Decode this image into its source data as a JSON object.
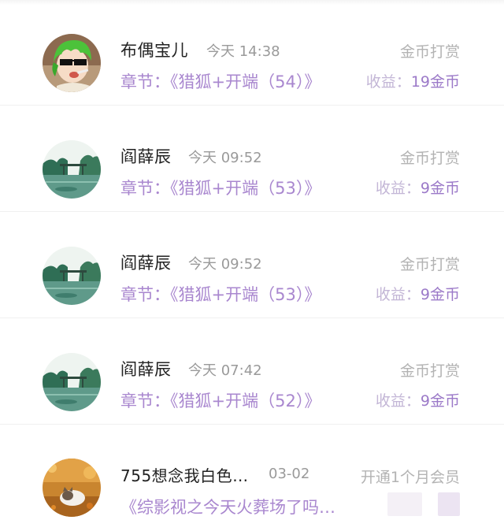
{
  "income_list": [
    {
      "name": "布偶宝儿",
      "time": "今天 14:38",
      "type": "金币打赏",
      "chapter": "章节：《猎狐+开端（54）》",
      "earning_label": "收益：",
      "earning_value": "19金币",
      "avatar": "anime-avatar"
    },
    {
      "name": "阎薛辰",
      "time": "今天 09:52",
      "type": "金币打赏",
      "chapter": "章节：《猎狐+开端（53）》",
      "earning_label": "收益：",
      "earning_value": "9金币",
      "avatar": "landscape-avatar"
    },
    {
      "name": "阎薛辰",
      "time": "今天 09:52",
      "type": "金币打赏",
      "chapter": "章节：《猎狐+开端（53）》",
      "earning_label": "收益：",
      "earning_value": "9金币",
      "avatar": "landscape-avatar"
    },
    {
      "name": "阎薛辰",
      "time": "今天 07:42",
      "type": "金币打赏",
      "chapter": "章节：《猎狐+开端（52）》",
      "earning_label": "收益：",
      "earning_value": "9金币",
      "avatar": "landscape-avatar"
    },
    {
      "name": "755想念我白色…",
      "time": "03-02",
      "type": "开通1个月会员",
      "chapter": "《综影视之今天火葬场了吗…",
      "earning_label": "",
      "earning_value": "",
      "avatar": "cat-autumn-avatar"
    }
  ],
  "colors": {
    "name": "#222222",
    "time": "#9a9a9a",
    "type": "#b3b3b3",
    "chapter": "#a987cf",
    "earning_value": "#9b79c8"
  }
}
